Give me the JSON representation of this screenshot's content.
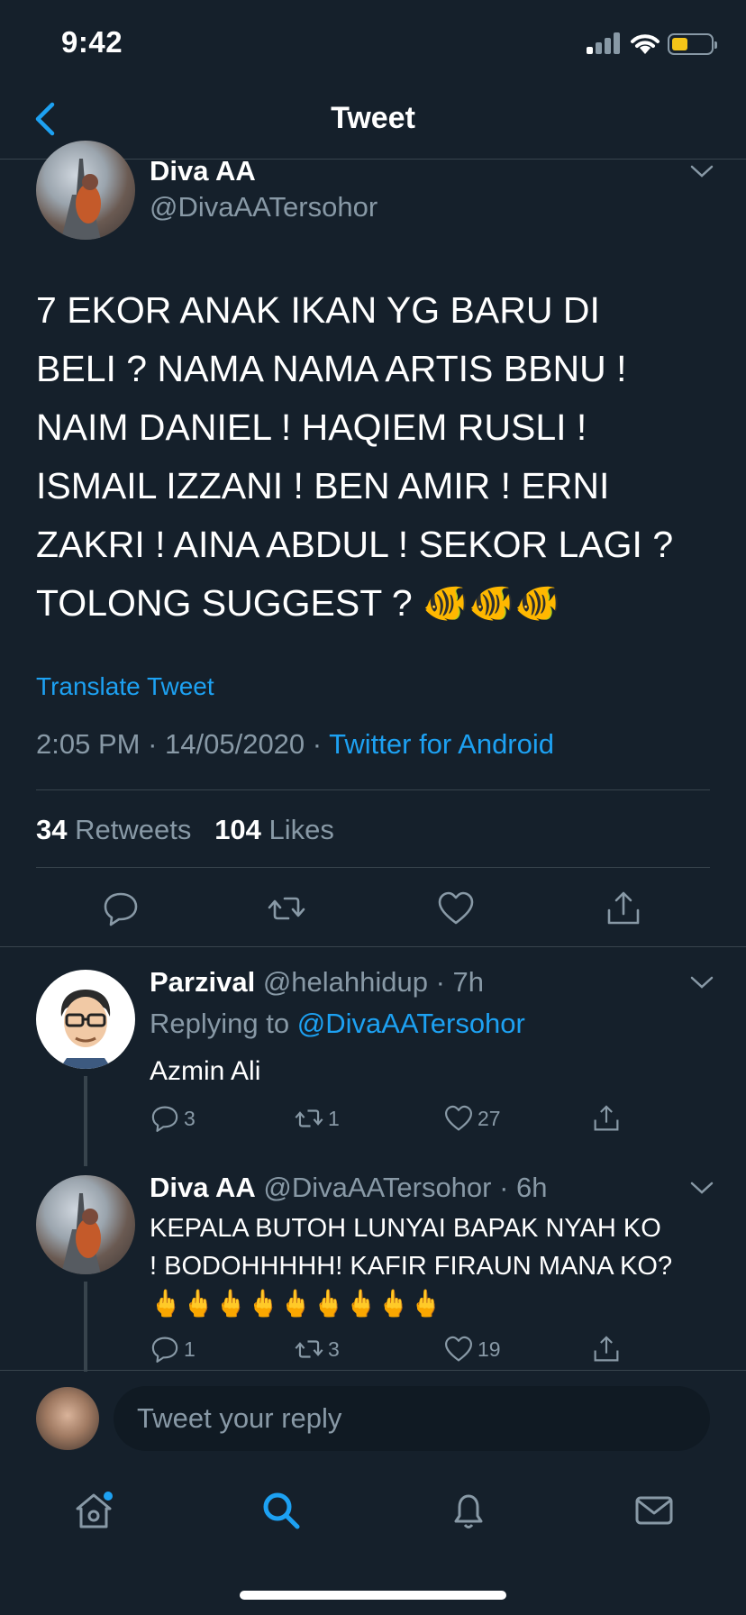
{
  "status_bar": {
    "time": "9:42"
  },
  "nav": {
    "title": "Tweet"
  },
  "tweet": {
    "author_name": "Diva AA",
    "author_handle": "@DivaAATersohor",
    "text": "7 EKOR ANAK IKAN YG BARU DI\nBELI ? NAMA NAMA ARTIS BBNU !\nNAIM DANIEL ! HAQIEM RUSLI !\nISMAIL IZZANI ! BEN AMIR ! ERNI\nZAKRI ! AINA ABDUL ! SEKOR LAGI ?\nTOLONG SUGGEST ? 🐠🐠🐠",
    "translate_label": "Translate Tweet",
    "time": "2:05 PM",
    "date": "14/05/2020",
    "source": "Twitter for Android",
    "separator": " · ",
    "retweets_count": "34",
    "retweets_label": "Retweets",
    "likes_count": "104",
    "likes_label": "Likes"
  },
  "replies": [
    {
      "name": "Parzival",
      "handle": "@helahhidup",
      "age": "· 7h",
      "replying_prefix": "Replying to ",
      "replying_to": "@DivaAATersohor",
      "text": "Azmin Ali",
      "reply_count": "3",
      "retweet_count": "1",
      "like_count": "27"
    },
    {
      "name": "Diva AA",
      "handle": "@DivaAATersohor",
      "age": "· 6h",
      "text": "KEPALA BUTOH LUNYAI BAPAK NYAH KO\n! BODOHHHHH! KAFIR FIRAUN MANA KO?\n🖕🖕🖕🖕🖕🖕🖕🖕🖕",
      "reply_count": "1",
      "retweet_count": "3",
      "like_count": "19"
    }
  ],
  "composer": {
    "placeholder": "Tweet your reply"
  },
  "tabbar": {
    "items": [
      "home-icon",
      "search-icon",
      "notifications-icon",
      "messages-icon"
    ]
  },
  "colors": {
    "background": "#15202b",
    "accent": "#1da1f2",
    "muted": "#8899a6",
    "divider": "#38444d"
  }
}
